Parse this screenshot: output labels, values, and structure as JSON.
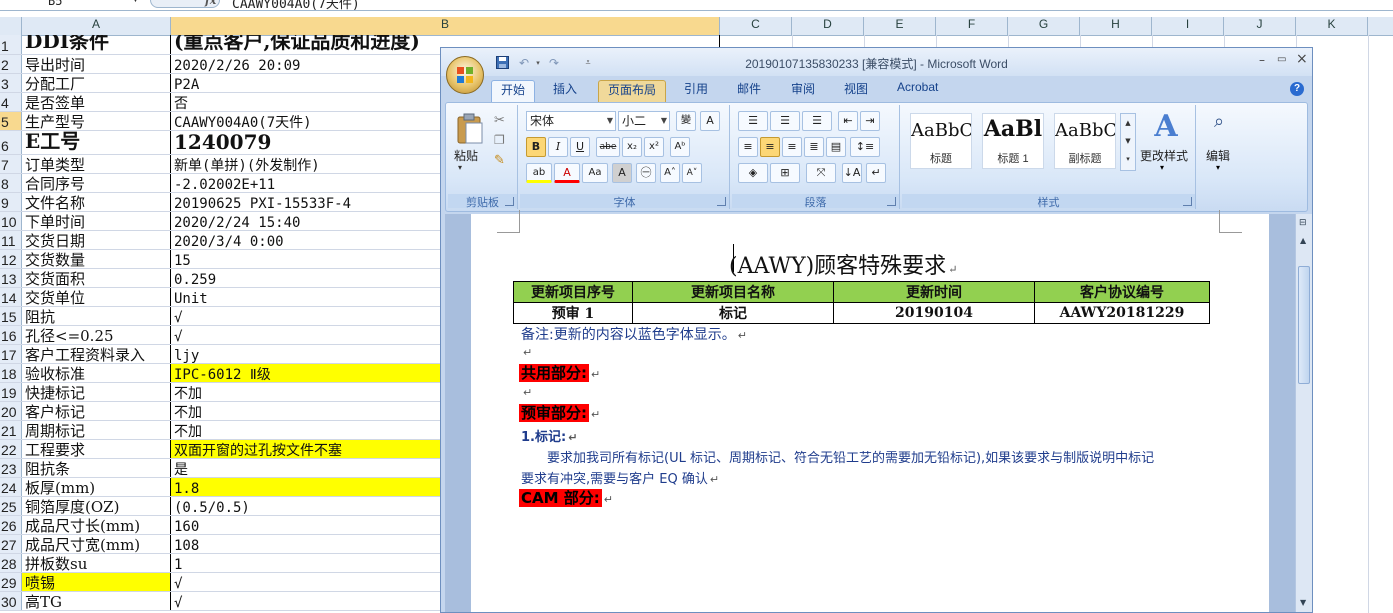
{
  "excel": {
    "name_box": "B5",
    "formula": "CAAWY004A0(7天件)",
    "columns": [
      "A",
      "B",
      "C",
      "D",
      "E",
      "F",
      "G",
      "H",
      "I",
      "J",
      "K"
    ],
    "rows": [
      {
        "n": "1",
        "a": "DDI条件",
        "b": "(重点客户,保证品质和进度)",
        "style": "big"
      },
      {
        "n": "2",
        "a": "导出时间",
        "b": "2020/2/26 20:09"
      },
      {
        "n": "3",
        "a": "分配工厂",
        "b": "P2A"
      },
      {
        "n": "4",
        "a": "是否签单",
        "b": "否"
      },
      {
        "n": "5",
        "a": "生产型号",
        "b": "CAAWY004A0(7天件)",
        "selected": true
      },
      {
        "n": "6",
        "a": "E工号",
        "b": "1240079",
        "style": "big"
      },
      {
        "n": "7",
        "a": "订单类型",
        "b": "新单(单拼)(外发制作)"
      },
      {
        "n": "8",
        "a": "合同序号",
        "b": "-2.02002E+11"
      },
      {
        "n": "9",
        "a": "文件名称",
        "b": "20190625_PXI-15533F-4"
      },
      {
        "n": "10",
        "a": "下单时间",
        "b": "2020/2/24 15:40"
      },
      {
        "n": "11",
        "a": "交货日期",
        "b": "2020/3/4 0:00"
      },
      {
        "n": "12",
        "a": "交货数量",
        "b": "15"
      },
      {
        "n": "13",
        "a": "交货面积",
        "b": "0.259"
      },
      {
        "n": "14",
        "a": "交货单位",
        "b": "Unit"
      },
      {
        "n": "15",
        "a": "阻抗",
        "b": "√"
      },
      {
        "n": "16",
        "a": "孔径<=0.25",
        "b": "√"
      },
      {
        "n": "17",
        "a": "客户工程资料录入",
        "b": "ljy"
      },
      {
        "n": "18",
        "a": "验收标准",
        "b": "IPC-6012 Ⅱ级",
        "hl_b": true
      },
      {
        "n": "19",
        "a": "快捷标记",
        "b": "不加"
      },
      {
        "n": "20",
        "a": "客户标记",
        "b": "不加"
      },
      {
        "n": "21",
        "a": "周期标记",
        "b": "不加"
      },
      {
        "n": "22",
        "a": "工程要求",
        "b": "双面开窗的过孔按文件不塞",
        "hl_b": true
      },
      {
        "n": "23",
        "a": "阻抗条",
        "b": "是"
      },
      {
        "n": "24",
        "a": "板厚(mm)",
        "b": "1.8",
        "hl_b": true
      },
      {
        "n": "25",
        "a": "铜箔厚度(OZ)",
        "b": "(0.5/0.5)"
      },
      {
        "n": "26",
        "a": "成品尺寸长(mm)",
        "b": "160"
      },
      {
        "n": "27",
        "a": "成品尺寸宽(mm)",
        "b": "108"
      },
      {
        "n": "28",
        "a": "拼板数su",
        "b": "1"
      },
      {
        "n": "29",
        "a": "喷锡",
        "b": "√",
        "hl_a": true
      },
      {
        "n": "30",
        "a": "高TG",
        "b": "√"
      }
    ]
  },
  "word": {
    "title": "20190107135830233 [兼容模式] - Microsoft Word",
    "tabs": [
      "开始",
      "插入",
      "页面布局",
      "引用",
      "邮件",
      "审阅",
      "视图",
      "Acrobat"
    ],
    "active_tab": "开始",
    "groups": {
      "clipboard": "剪贴板",
      "font": "字体",
      "paragraph": "段落",
      "styles": "样式",
      "paste": "粘贴",
      "change_styles": "更改样式",
      "edit": "编辑"
    },
    "font_name": "宋体",
    "font_size": "小二",
    "style_items": [
      {
        "sample": "AaBbC(",
        "name": "标题"
      },
      {
        "sample": "AaBl",
        "name": "标题 1"
      },
      {
        "sample": "AaBbC(",
        "name": "副标题"
      }
    ],
    "document": {
      "title": "(AAWY)顾客特殊要求",
      "table_headers": [
        "更新项目序号",
        "更新项目名称",
        "更新时间",
        "客户协议编号"
      ],
      "table_row": [
        "预审 1",
        "标记",
        "20190104",
        "AAWY20181229"
      ],
      "note": "备注:更新的内容以蓝色字体显示。",
      "section_common": "共用部分:",
      "section_pre": "预审部分:",
      "item1_title": "1.标记:",
      "item1_body_line1": "要求加我司所有标记(UL 标记、周期标记、符合无铅工艺的需要加无铅标记),如果该要求与制版说明中标记",
      "item1_body_line2": "要求有冲突,需要与客户 EQ 确认",
      "section_cam": "CAM 部分:"
    }
  },
  "colors": {
    "excel_header": "#dfe9f5",
    "highlight_yellow": "#ffff00",
    "table_header_green": "#92d050",
    "section_red": "#ff0000",
    "note_blue": "#1f3c8c"
  }
}
